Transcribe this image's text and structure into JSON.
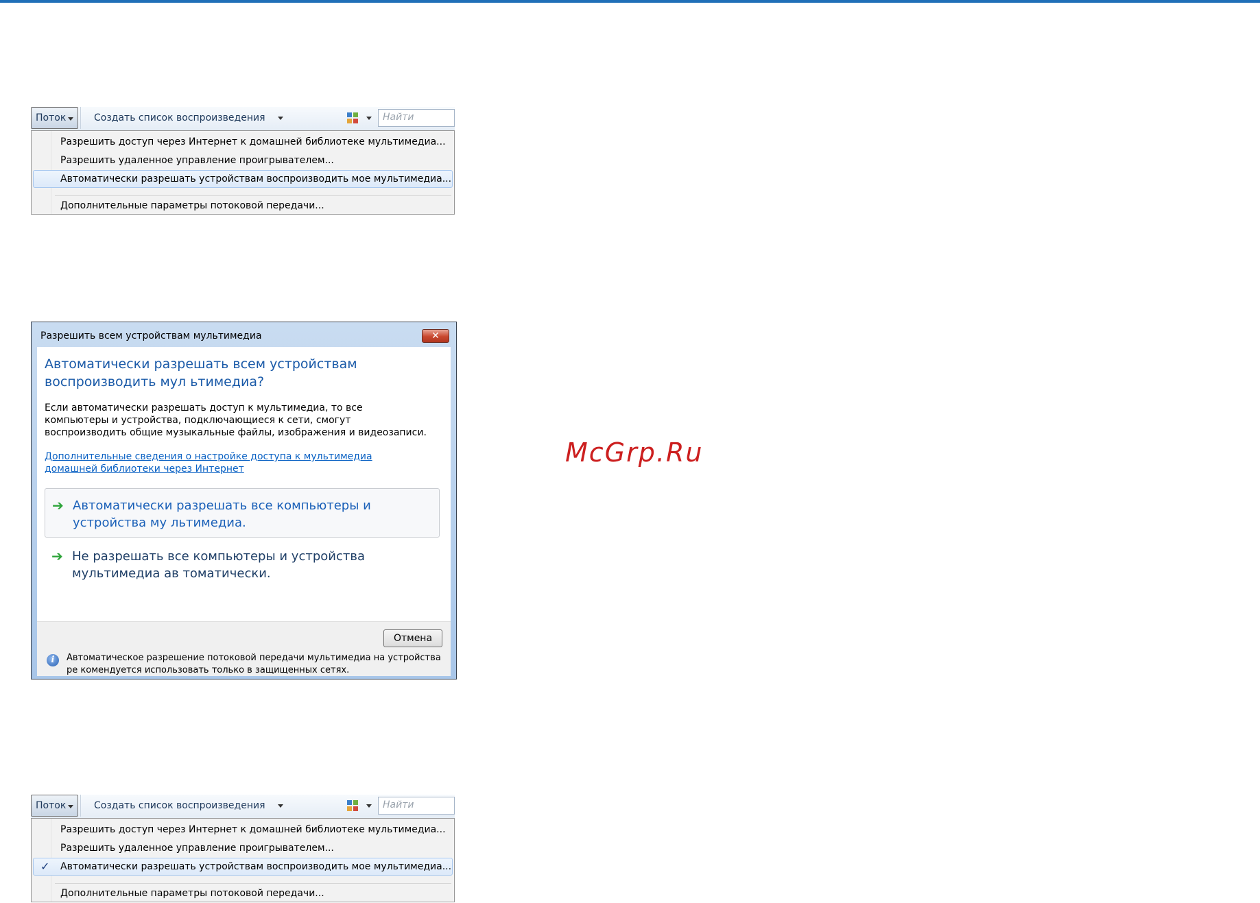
{
  "toolbar": {
    "stream_label": "Поток",
    "create_playlist_label": "Создать список воспроизведения",
    "search_placeholder": "Найти"
  },
  "menu": {
    "items": [
      "Разрешить доступ через Интернет к домашней библиотеке мультимедиа...",
      "Разрешить удаленное управление проигрывателем...",
      "Автоматически разрешать устройствам воспроизводить мое мультимедиа...",
      "Дополнительные параметры потоковой передачи..."
    ],
    "checkmark": "✓"
  },
  "dialog": {
    "title": "Разрешить всем устройствам мультимедиа",
    "close_glyph": "✕",
    "heading": "Автоматически разрешать всем устройствам воспроизводить мул ьтимедиа?",
    "description": "Если автоматически разрешать доступ к мультимедиа, то все компьютеры и устройства, подключающиеся к сети, смогут воспроизводить общие музыкальные файлы, изображения и видеозаписи.",
    "link": "Дополнительные сведения о настройке доступа к мультимедиа домашней библиотеки через Интернет",
    "option_allow": "Автоматически разрешать все компьютеры и устройства му льтимедиа.",
    "option_deny": "Не разрешать все компьютеры и устройства мультимедиа ав томатически.",
    "cancel_label": "Отмена",
    "info_text": "Автоматическое разрешение потоковой передачи мультимедиа на устройства ре комендуется использовать только в защищенных сетях.",
    "arrow_glyph": "➔",
    "info_glyph": "i"
  },
  "watermark": "McGrp.Ru",
  "colors": {
    "accent_line": "#1f6fb8",
    "dialog_heading": "#1a5aa8",
    "link": "#0b62c4",
    "arrow": "#2ea43a",
    "watermark": "#cc1f1f"
  }
}
